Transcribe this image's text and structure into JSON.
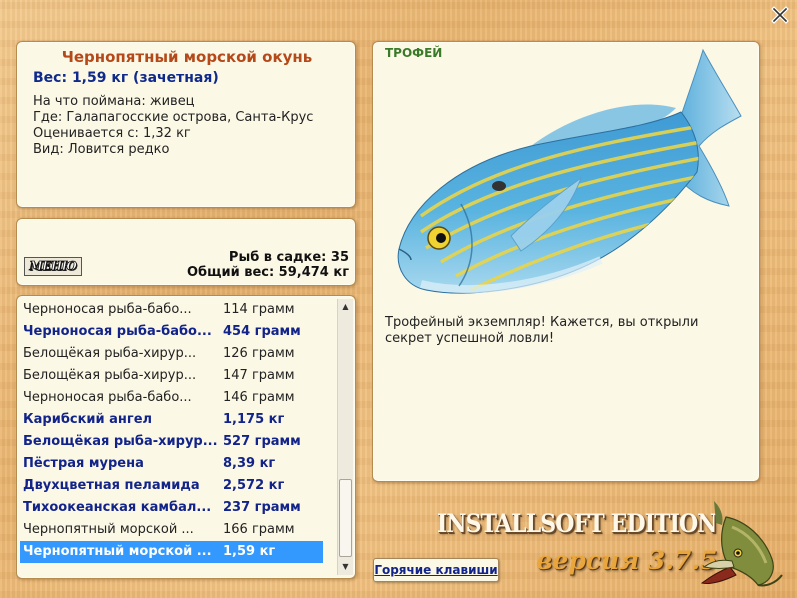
{
  "info": {
    "title": "Чернопятный морской окунь",
    "weight": "Вес: 1,59 кг (зачетная)",
    "lines": [
      "На что поймана: живец",
      "Где: Галапагосские острова, Санта-Крус",
      "Оценивается с: 1,32 кг",
      "Вид: Ловится редко"
    ]
  },
  "stats": {
    "menu_label": "МЕНЮ",
    "fish_count": "Рыб в садке: 35",
    "total_weight": "Общий вес: 59,474 кг"
  },
  "catch_list": [
    {
      "name": "Черноносая рыба-бабо...",
      "weight": "114 грамм",
      "style": "plain"
    },
    {
      "name": "Черноносая рыба-бабо...",
      "weight": "454 грамм",
      "style": "bold"
    },
    {
      "name": "Белощёкая рыба-хирур...",
      "weight": "126 грамм",
      "style": "plain"
    },
    {
      "name": "Белощёкая рыба-хирур...",
      "weight": "147 грамм",
      "style": "plain"
    },
    {
      "name": "Черноносая рыба-бабо...",
      "weight": "146 грамм",
      "style": "plain"
    },
    {
      "name": "Карибский ангел",
      "weight": "1,175 кг",
      "style": "bold"
    },
    {
      "name": "Белощёкая рыба-хирур...",
      "weight": "527 грамм",
      "style": "bold"
    },
    {
      "name": "Пёстрая мурена",
      "weight": "8,39 кг",
      "style": "bold"
    },
    {
      "name": "Двухцветная пеламида",
      "weight": "2,572 кг",
      "style": "bold"
    },
    {
      "name": "Тихоокеанская камбал...",
      "weight": "237 грамм",
      "style": "bold"
    },
    {
      "name": "Чернопятный морской ...",
      "weight": "166 грамм",
      "style": "plain"
    },
    {
      "name": "Чернопятный морской ...",
      "weight": "1,59 кг",
      "style": "selected"
    }
  ],
  "trophy": {
    "label": "ТРОФЕЙ",
    "text": "Трофейный экземпляр! Кажется, вы открыли секрет успешной ловли!"
  },
  "footer": {
    "hotkeys_label": "Горячие клавиши",
    "edition": "INSTALLSOFT EDITION",
    "version": "версия 3.7.5"
  },
  "colors": {
    "title": "#b4491a",
    "highlight_text": "#12248a",
    "selection": "#3399ff",
    "panel": "#fcf8e6"
  },
  "icons": {
    "close": "close-icon",
    "scroll_up": "arrow-up-icon",
    "scroll_down": "arrow-down-icon",
    "logo": "pike-fish-logo"
  }
}
